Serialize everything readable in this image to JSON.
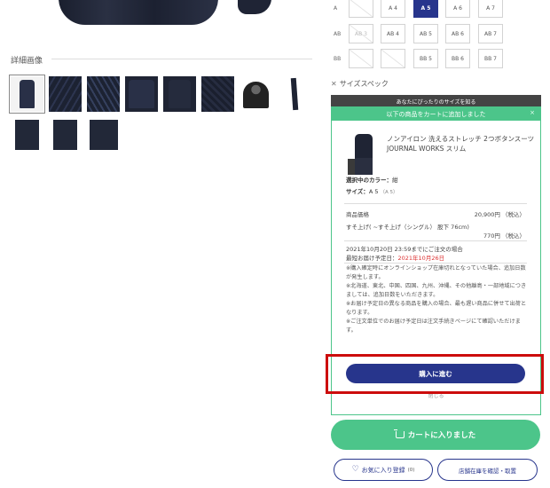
{
  "gallery": {
    "section_title": "詳細画像"
  },
  "size_grid": {
    "rows": [
      {
        "label": "A",
        "cells": [
          {
            "text": "",
            "state": "disabled"
          },
          {
            "text": "A 4",
            "state": "normal"
          },
          {
            "text": "A 5",
            "state": "active"
          },
          {
            "text": "A 6",
            "state": "normal"
          },
          {
            "text": "A 7",
            "state": "normal"
          }
        ]
      },
      {
        "label": "AB",
        "cells": [
          {
            "text": "AB 3",
            "state": "disabled"
          },
          {
            "text": "AB 4",
            "state": "normal"
          },
          {
            "text": "AB 5",
            "state": "normal"
          },
          {
            "text": "AB 6",
            "state": "normal"
          },
          {
            "text": "AB 7",
            "state": "normal"
          }
        ]
      },
      {
        "label": "BB",
        "cells": [
          {
            "text": "",
            "state": "disabled"
          },
          {
            "text": "",
            "state": "disabled"
          },
          {
            "text": "BB 5",
            "state": "normal"
          },
          {
            "text": "BB 6",
            "state": "normal"
          },
          {
            "text": "BB 7",
            "state": "normal"
          }
        ]
      }
    ],
    "size_spec_label": "サイズスペック",
    "fit_bar_label": "あなたにぴったりのサイズを知る"
  },
  "modal": {
    "header": "以下の商品をカートに追加しました",
    "product_name": "ノンアイロン 洗えるストレッチ 2つボタンスーツ JOURNAL WORKS スリム",
    "color_label": "選択中のカラー：",
    "color_value": "紺",
    "size_label": "サイズ：",
    "size_value": "A 5",
    "size_sub": "（A 5）",
    "price_label": "商品価格",
    "price_value": "20,900円 （税込）",
    "hem_label": "すそ上げ( ~すそ上げ（シングル） 股下 76cm)",
    "hem_value": "770円 （税込）",
    "order_deadline": "2021年10月20日 23:59までにご注文の場合",
    "earliest_label": "最短お届け予定日：",
    "earliest_date": "2021年10月26日",
    "notes": "※購入確定時にオンラインショップ在庫切れとなっていた場合、追加日数が発生します。\n※北海道、東北、中国、四国、九州、沖縄、その他離島・一部地域につきましては、追加日数をいただきます。\n※お届け予定日の異なる商品を購入の場合、最も遅い商品に併せて出荷となります。\n※ご注文単位でのお届け予定日は注文手続きページにて確認いただけます。",
    "proceed_label": "購入に進む",
    "close_label": "閉じる"
  },
  "cart_button_label": "カートに入りました",
  "fav_button_label": "お気に入り登録",
  "fav_count": "(0)",
  "store_button_label": "店舗在庫を確認・取置",
  "colors": {
    "accent_green": "#4cc58a",
    "brand_navy": "#27358c",
    "highlight_red": "#cc0c0c"
  }
}
